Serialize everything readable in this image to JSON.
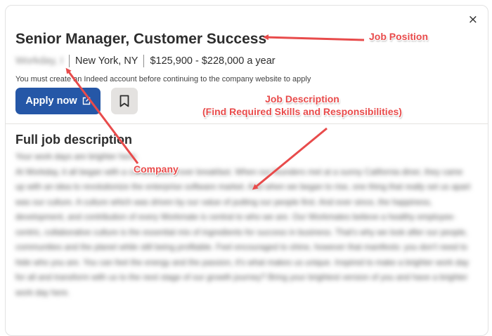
{
  "job": {
    "title": "Senior Manager, Customer Success",
    "company": "Workday, Inc.",
    "location": "New York, NY",
    "salary": "$125,900 - $228,000 a year",
    "notice": "You must create an Indeed account before continuing to the company website to apply",
    "apply_label": "Apply now",
    "close_symbol": "×"
  },
  "description": {
    "heading": "Full job description",
    "tagline": "Your work days are brighter here.",
    "paragraph": "At Workday, it all began with a conversation over breakfast. When our founders met at a sunny California diner, they came up with an idea to revolutionize the enterprise software market. And when we began to rise, one thing that really set us apart was our culture. A culture which was driven by our value of putting our people first. And ever since, the happiness, development, and contribution of every Workmate is central to who we are. Our Workmates believe a healthy employee-centric, collaborative culture is the essential mix of ingredients for success in business. That's why we look after our people, communities and the planet while still being profitable. Feel encouraged to shine, however that manifests: you don't need to hide who you are. You can feel the energy and the passion, it's what makes us unique. Inspired to make a brighter work day for all and transform with us to the next stage of our growth journey? Bring your brightest version of you and have a brighter work day here."
  },
  "annotations": {
    "job_position": "Job Position",
    "job_description_line1": "Job Description",
    "job_description_line2": "(Find Required Skills and Responsibilities)",
    "company": "Company"
  },
  "colors": {
    "apply_button": "#2557a7",
    "annotation": "#e84b4b"
  },
  "icons": {
    "close": "close-icon",
    "external_link": "external-link-icon",
    "bookmark": "bookmark-icon"
  }
}
